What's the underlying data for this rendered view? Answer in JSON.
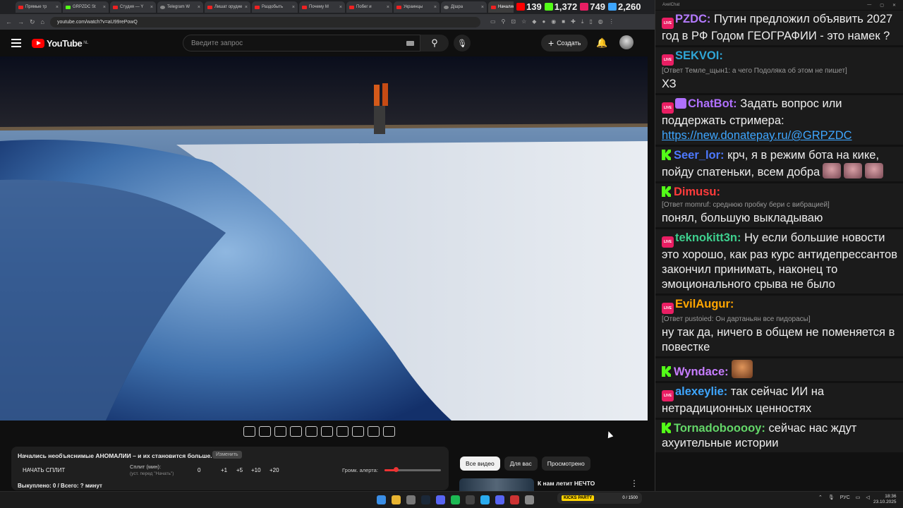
{
  "browser": {
    "tabs": [
      {
        "label": "Прямые тр",
        "icon": "youtube"
      },
      {
        "label": "GRPZDC St",
        "icon": "kick"
      },
      {
        "label": "Студия — Y",
        "icon": "youtube"
      },
      {
        "label": "Telegram W",
        "icon": "telegram"
      },
      {
        "label": "Лишат орудие",
        "icon": "youtube"
      },
      {
        "label": "Раздобыть",
        "icon": "youtube"
      },
      {
        "label": "Почему М",
        "icon": "youtube"
      },
      {
        "label": "Побег и",
        "icon": "youtube"
      },
      {
        "label": "Украинцы",
        "icon": "youtube"
      },
      {
        "label": "Д|шра",
        "icon": "other"
      },
      {
        "label": "Начались",
        "icon": "youtube"
      }
    ],
    "url": "youtube.com/watch?v=aU99rePowQ"
  },
  "stream_stats": [
    {
      "value": "139",
      "color": "#ff0000"
    },
    {
      "value": "1,372",
      "color": "#53fc18"
    },
    {
      "value": "749",
      "color": "#e91e63"
    },
    {
      "value": "2,260",
      "color": "#3ea6ff"
    }
  ],
  "youtube": {
    "logo": "YouTube",
    "region": "NL",
    "search_placeholder": "Введите запрос",
    "create_label": "Создать"
  },
  "panel": {
    "video_title": "Начались необъяснимые АНОМАЛИИ – и их становится больше.",
    "tag": "Изменить",
    "split_button": "НАЧАТЬ СПЛИТ",
    "split_label": "Сплит (мин):",
    "split_hint": "(уст. перед \"Начать\")",
    "split_value": "0",
    "increments": [
      "+1",
      "+5",
      "+10",
      "+20"
    ],
    "alert_label": "Громк. алерта:",
    "alert_level": 0.2,
    "bought": "Выкуплено: 0 / Всего: ? минут"
  },
  "chips": [
    "Все видео",
    "Для вас",
    "Просмотрено"
  ],
  "recommendation": {
    "title": "К нам летит НЕЧТО"
  },
  "chat": {
    "window_title": "AxelChat",
    "messages": [
      {
        "platform": "live",
        "user": "PZDC:",
        "color": "#b57bff",
        "text": "Путин предложил объявить 2027 год в РФ Годом ГЕОГРАФИИ - это намек ?"
      },
      {
        "platform": "live",
        "user": "SEKVOI:",
        "color": "#2fa6d6",
        "reply": "[Ответ Темле_щын1: а чего Подоляка об этом не пишет]",
        "text": "ХЗ"
      },
      {
        "platform": "live-bot",
        "user": "ChatBot:",
        "color": "#b070ff",
        "text": "Задать вопрос или поддержать стримера:",
        "link": "https://new.donatepay.ru/@GRPZDC"
      },
      {
        "platform": "kick",
        "user": "Seer_lor:",
        "color": "#4d79ff",
        "text": "крч, я в режим бота на кике, пойду спатеньки, всем добра"
      },
      {
        "platform": "kick",
        "user": "Dimusu:",
        "color": "#ff3b3b",
        "reply": "[Ответ momruf: среднюю пробку бери с вибрацией]",
        "text": "понял, большую выкладываю"
      },
      {
        "platform": "live",
        "user": "teknokitt3n:",
        "color": "#3ecf8e",
        "text": "Ну если большие новости это хорошо, как раз курс антидепрессантов закончил принимать, наконец то эмоционального срыва не было"
      },
      {
        "platform": "live",
        "user": "EvilAugur:",
        "color": "#ffa500",
        "reply": "[Ответ pustoied: Он дартаньян все пидорасы]",
        "text": "ну так да, ничего в общем не поменяется в повестке"
      },
      {
        "platform": "kick",
        "user": "Wyndace:",
        "color": "#c77dff",
        "text": ""
      },
      {
        "platform": "live",
        "user": "alexeylie:",
        "color": "#3ea6ff",
        "text": "так сейчас ИИ на нетрадиционных ценностях"
      },
      {
        "platform": "kick",
        "user": "Tornadobooooy:",
        "color": "#63d668",
        "text": "сейчас нас ждут ахуительные истории"
      }
    ]
  },
  "taskbar": {
    "widget_label": "KICKS PARTY",
    "widget_progress": "0 / 1500",
    "lang": "РУС",
    "time": "18:36",
    "date": "23.10.2025"
  }
}
